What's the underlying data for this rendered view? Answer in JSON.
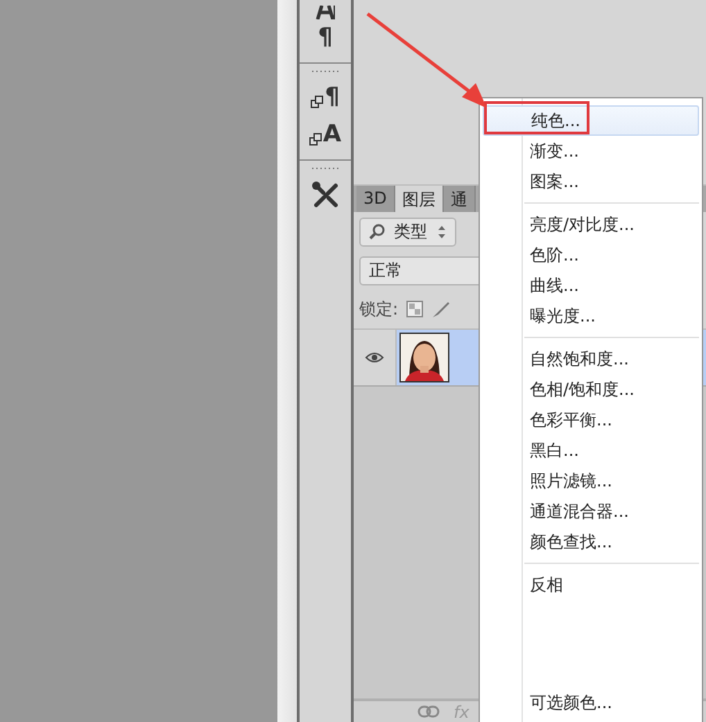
{
  "tool_icons": [
    {
      "kind": "type-tool"
    },
    {
      "kind": "glyph",
      "glyph": "¶"
    },
    {
      "kind": "grip"
    },
    {
      "kind": "boxed-glyph",
      "glyph": "¶"
    },
    {
      "kind": "boxed-glyph",
      "glyph": "A"
    },
    {
      "kind": "grip"
    },
    {
      "kind": "tools"
    }
  ],
  "layers_panel": {
    "tabs": [
      {
        "label": "3D",
        "selected": false
      },
      {
        "label": "图层",
        "selected": true
      },
      {
        "label": "通",
        "selected": false
      }
    ],
    "filter": {
      "value": "类型"
    },
    "blend_mode": {
      "value": "正常"
    },
    "lock_label": "锁定:",
    "layers": [
      {
        "visible": true,
        "selected": true
      }
    ],
    "footer": {
      "fx": "fx"
    }
  },
  "context_menu": {
    "items": [
      {
        "kind": "item",
        "label": "纯色...",
        "selected": true,
        "highlighted": true
      },
      {
        "kind": "item",
        "label": "渐变...",
        "selected": false,
        "highlighted": false
      },
      {
        "kind": "item",
        "label": "图案...",
        "selected": false,
        "highlighted": false
      },
      {
        "kind": "separator"
      },
      {
        "kind": "item",
        "label": "亮度/对比度...",
        "selected": false,
        "highlighted": false
      },
      {
        "kind": "item",
        "label": "色阶...",
        "selected": false,
        "highlighted": false
      },
      {
        "kind": "item",
        "label": "曲线...",
        "selected": false,
        "highlighted": false
      },
      {
        "kind": "item",
        "label": "曝光度...",
        "selected": false,
        "highlighted": false
      },
      {
        "kind": "separator"
      },
      {
        "kind": "item",
        "label": "自然饱和度...",
        "selected": false,
        "highlighted": false
      },
      {
        "kind": "item",
        "label": "色相/饱和度...",
        "selected": false,
        "highlighted": false
      },
      {
        "kind": "item",
        "label": "色彩平衡...",
        "selected": false,
        "highlighted": false
      },
      {
        "kind": "item",
        "label": "黑白...",
        "selected": false,
        "highlighted": false
      },
      {
        "kind": "item",
        "label": "照片滤镜...",
        "selected": false,
        "highlighted": false
      },
      {
        "kind": "item",
        "label": "通道混合器...",
        "selected": false,
        "highlighted": false
      },
      {
        "kind": "item",
        "label": "颜色查找...",
        "selected": false,
        "highlighted": false
      },
      {
        "kind": "separator"
      },
      {
        "kind": "item",
        "label": "反相",
        "selected": false,
        "highlighted": false
      },
      {
        "kind": "item",
        "label": "可选颜色...",
        "selected": false,
        "highlighted": false
      }
    ]
  },
  "annotation": {
    "arrow": true
  }
}
